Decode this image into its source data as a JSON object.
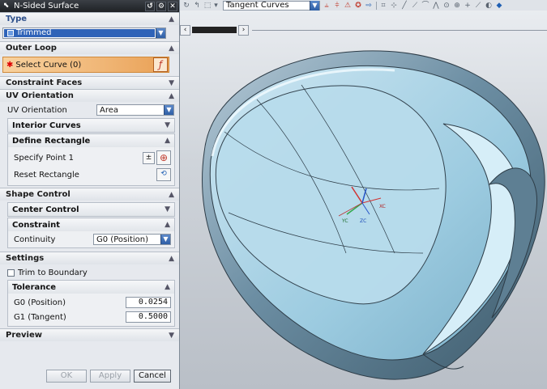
{
  "dialog": {
    "title": "N-Sided Surface",
    "title_buttons": [
      "↺",
      "⚙",
      "✕"
    ],
    "type_section": {
      "header": "Type",
      "value": "Trimmed"
    },
    "outer_loop": {
      "header": "Outer Loop",
      "select_label": "Select Curve (0)"
    },
    "constraint_faces": {
      "header": "Constraint Faces"
    },
    "uv_orientation": {
      "header": "UV Orientation",
      "label": "UV Orientation",
      "value": "Area",
      "interior_curves": "Interior Curves",
      "define_rectangle": "Define Rectangle",
      "specify_point": "Specify Point 1",
      "reset_rectangle": "Reset Rectangle"
    },
    "shape_control": {
      "header": "Shape Control",
      "center_control": "Center Control",
      "constraint": "Constraint",
      "continuity_label": "Continuity",
      "continuity_value": "G0 (Position)"
    },
    "settings": {
      "header": "Settings",
      "trim_to_boundary": "Trim to Boundary",
      "tolerance": "Tolerance",
      "g0_label": "G0 (Position)",
      "g0_value": "0.0254",
      "g1_label": "G1 (Tangent)",
      "g1_value": "0.5000"
    },
    "preview": {
      "header": "Preview"
    },
    "buttons": {
      "ok": "OK",
      "apply": "Apply",
      "cancel": "Cancel"
    }
  },
  "toolbar": {
    "selection_filter": "Tangent Curves"
  },
  "colors": {
    "accent": "#2f63b8",
    "surface": "#8fc4dc",
    "select_highlight": "#f0b676"
  }
}
